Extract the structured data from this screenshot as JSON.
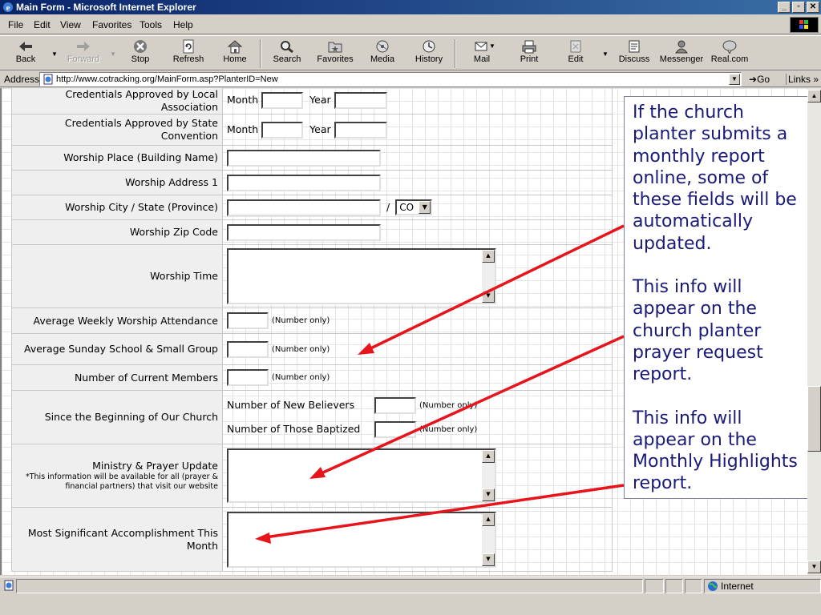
{
  "window": {
    "title": "Main Form - Microsoft Internet Explorer"
  },
  "menu": [
    "File",
    "Edit",
    "View",
    "Favorites",
    "Tools",
    "Help"
  ],
  "toolbar": {
    "back": "Back",
    "forward": "Forward",
    "stop": "Stop",
    "refresh": "Refresh",
    "home": "Home",
    "search": "Search",
    "favorites": "Favorites",
    "media": "Media",
    "history": "History",
    "mail": "Mail",
    "print": "Print",
    "edit": "Edit",
    "discuss": "Discuss",
    "messenger": "Messenger",
    "realcom": "Real.com"
  },
  "address": {
    "label": "Address",
    "url": "http://www.cotracking.org/MainForm.asp?PlanterID=New",
    "go": "Go",
    "links": "Links"
  },
  "form": {
    "credentials_local": "Credentials Approved by Local Association",
    "credentials_state": "Credentials Approved by State Convention",
    "month": "Month",
    "year": "Year",
    "worship_place": "Worship Place (Building Name)",
    "worship_address": "Worship Address 1",
    "worship_city": "Worship City / State (Province)",
    "slash": "/",
    "state_value": "CO",
    "worship_zip": "Worship Zip Code",
    "worship_time": "Worship Time",
    "avg_attendance": "Average Weekly Worship Attendance",
    "avg_sunday_school": "Average Sunday School & Small Group",
    "current_members": "Number of Current Members",
    "number_only": "(Number only)",
    "since_beginning": "Since the Beginning of Our Church",
    "new_believers": "Number of New Believers",
    "baptized": "Number of Those Baptized",
    "ministry_update": "Ministry & Prayer Update",
    "ministry_note": "*This information will be available for all (prayer & financial partners) that visit our website",
    "accomplishment": "Most Significant Accomplishment This Month"
  },
  "callout": {
    "p1": "If the church planter submits a monthly report online, some of these fields will be automatically updated.",
    "p2": "This info will appear on the church planter prayer request report.",
    "p3": "This info will appear on the Monthly Highlights report."
  },
  "status": {
    "zone": "Internet"
  },
  "colors": {
    "titlebar": "#0a246a",
    "callout_text": "#1a1a7a",
    "arrow": "#e8141c"
  }
}
